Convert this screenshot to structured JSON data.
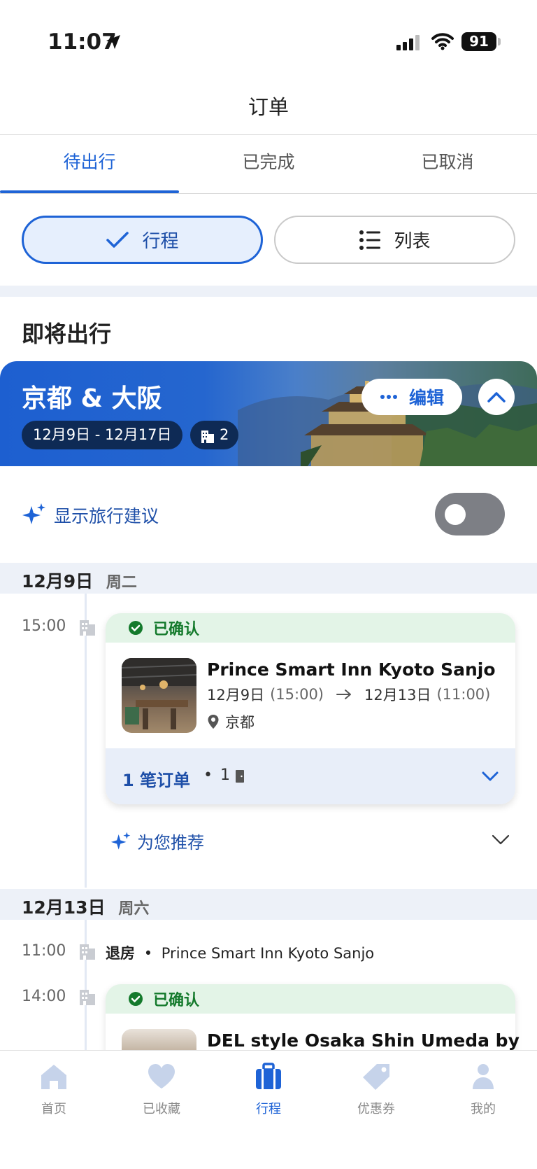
{
  "status_bar": {
    "time": "11:07",
    "battery": "91"
  },
  "header": {
    "title": "订单"
  },
  "tabs": [
    {
      "label": "待出行",
      "active": true
    },
    {
      "label": "已完成",
      "active": false
    },
    {
      "label": "已取消",
      "active": false
    }
  ],
  "view_toggle": {
    "trip_label": "行程",
    "list_label": "列表",
    "selected": "行程"
  },
  "section_title": "即将出行",
  "trip": {
    "title": "京都 & 大阪",
    "date_range": "12月9日 - 12月17日",
    "hotel_count": "2",
    "edit_label": "编辑"
  },
  "suggestions": {
    "label": "显示旅行建议",
    "enabled": false
  },
  "days": [
    {
      "date": "12月9日",
      "weekday": "周二",
      "events": [
        {
          "time": "15:00",
          "status": "已确认",
          "hotel_name": "Prince Smart Inn Kyoto Sanjo",
          "checkin_date": "12月9日",
          "checkin_time": "(15:00)",
          "checkout_date": "12月13日",
          "checkout_time": "(11:00)",
          "city": "京都",
          "orders_label": "1 笔订单",
          "separator": "•",
          "rooms": "1"
        }
      ],
      "recommend_label": "为您推荐"
    },
    {
      "date": "12月13日",
      "weekday": "周六",
      "events": [
        {
          "time": "11:00",
          "type_label": "退房",
          "separator": "•",
          "hotel_name": "Prince Smart Inn Kyoto Sanjo"
        },
        {
          "time": "14:00",
          "status": "已确认",
          "hotel_name": "DEL style Osaka Shin Umeda by"
        }
      ]
    }
  ],
  "bottom_nav": [
    {
      "label": "首页",
      "icon": "home-icon",
      "active": false
    },
    {
      "label": "已收藏",
      "icon": "heart-icon",
      "active": false
    },
    {
      "label": "行程",
      "icon": "suitcase-icon",
      "active": true
    },
    {
      "label": "优惠券",
      "icon": "tag-icon",
      "active": false
    },
    {
      "label": "我的",
      "icon": "person-icon",
      "active": false
    }
  ],
  "colors": {
    "accent": "#1e63d6",
    "confirmed_bg": "#e3f4e7",
    "confirmed_text": "#147a2c",
    "section_bg": "#edf1f8"
  }
}
